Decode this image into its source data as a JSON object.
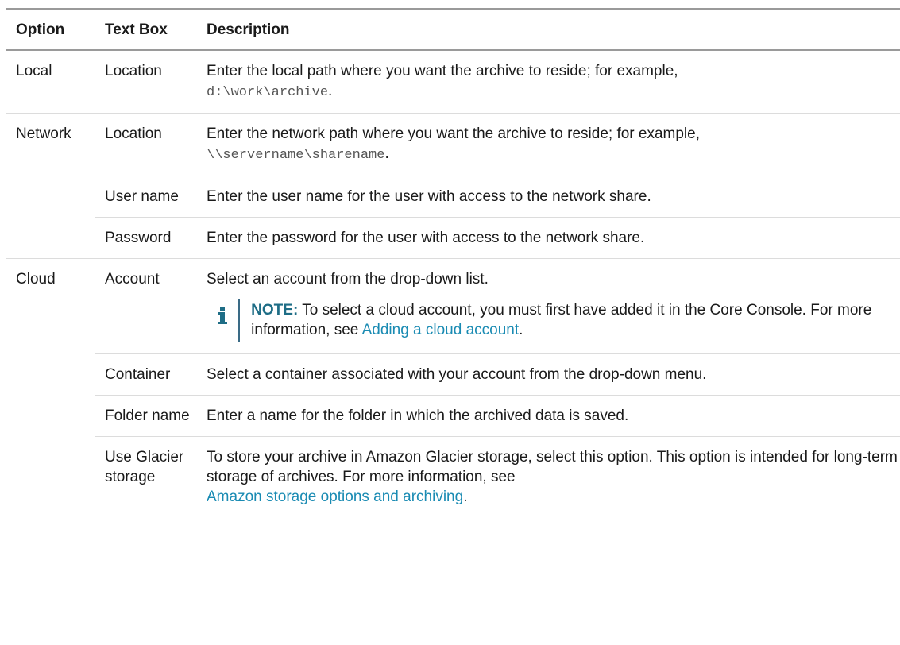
{
  "headers": [
    "Option",
    "Text Box",
    "Description"
  ],
  "rows": [
    {
      "option": "Local",
      "textbox": "Location",
      "desc_pre": "Enter the local path where you want the archive to reside; for example,",
      "desc_code": "d:\\work\\archive",
      "desc_post": "."
    },
    {
      "option": "Network",
      "textbox": "Location",
      "desc_pre": "Enter the network path where you want the archive to reside; for example,",
      "desc_code": "\\\\servername\\sharename",
      "desc_post": "."
    },
    {
      "option": "",
      "textbox": "User name",
      "desc": "Enter the user name for the user with access to the network share."
    },
    {
      "option": "",
      "textbox": "Password",
      "desc": "Enter the password for the user with access to the network share."
    },
    {
      "option": "Cloud",
      "textbox": "Account",
      "desc": "Select an account from the drop-down list.",
      "note": {
        "label": "NOTE:",
        "text": "To select a cloud account, you must first have added it in the Core Console. For more information, see",
        "link": "Adding a cloud account",
        "end": "."
      }
    },
    {
      "option": "",
      "textbox": "Container",
      "desc": "Select a container associated with your account from the drop-down menu."
    },
    {
      "option": "",
      "textbox": "Folder name",
      "desc": "Enter a name for the folder in which the archived data is saved."
    },
    {
      "option": "",
      "textbox": "Use Glacier storage",
      "desc_pre": "To store your archive in Amazon Glacier storage, select this option. This option is intended for long-term storage of archives. For more information, see",
      "desc_link": "Amazon storage options and archiving",
      "desc_post": "."
    }
  ],
  "icons": {
    "note": "info-icon"
  },
  "colors": {
    "link": "#1a8bb3",
    "note_label": "#1e6d86",
    "note_bar": "#3a6b86"
  }
}
